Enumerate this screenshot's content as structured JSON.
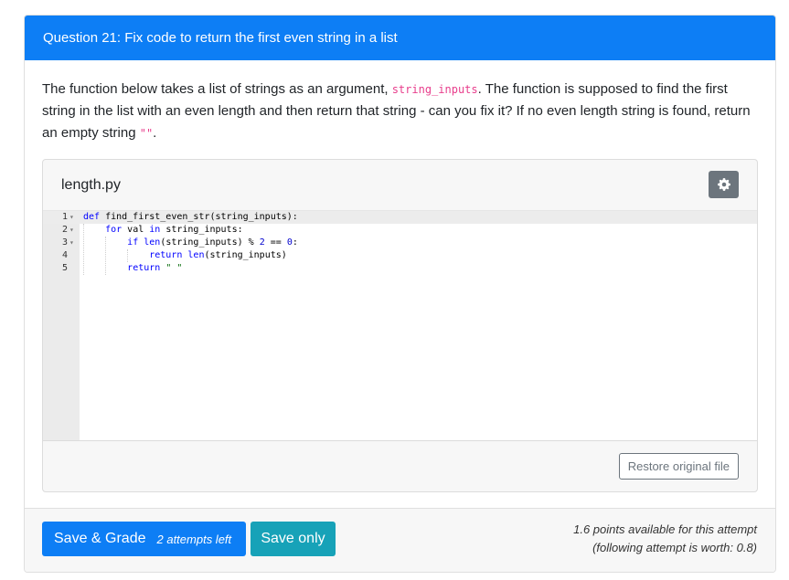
{
  "header": {
    "title": "Question 21: Fix code to return the first even string in a list"
  },
  "prompt": {
    "text_1": "The function below takes a list of strings as an argument, ",
    "code_1": "string_inputs",
    "text_2": ". The function is supposed to find the first string in the list with an even length and then return that string - can you fix it? If no even length string is found, return an empty string ",
    "code_2": "\"\"",
    "text_3": "."
  },
  "file": {
    "name": "length.py",
    "settings_icon": "gear-icon",
    "restore_label": "Restore original file",
    "code_lines": [
      {
        "n": "1",
        "fold": "▾"
      },
      {
        "n": "2",
        "fold": "▾"
      },
      {
        "n": "3",
        "fold": "▾"
      },
      {
        "n": "4",
        "fold": ""
      },
      {
        "n": "5",
        "fold": ""
      }
    ]
  },
  "footer": {
    "grade_label": "Save & Grade",
    "attempts_label": "2 attempts left",
    "save_label": "Save only",
    "points_line1": "1.6 points available for this attempt",
    "points_line2": "(following attempt is worth: 0.8)"
  },
  "colors": {
    "primary": "#0d7ef5",
    "info": "#17a2b8",
    "secondary": "#6c757d"
  }
}
